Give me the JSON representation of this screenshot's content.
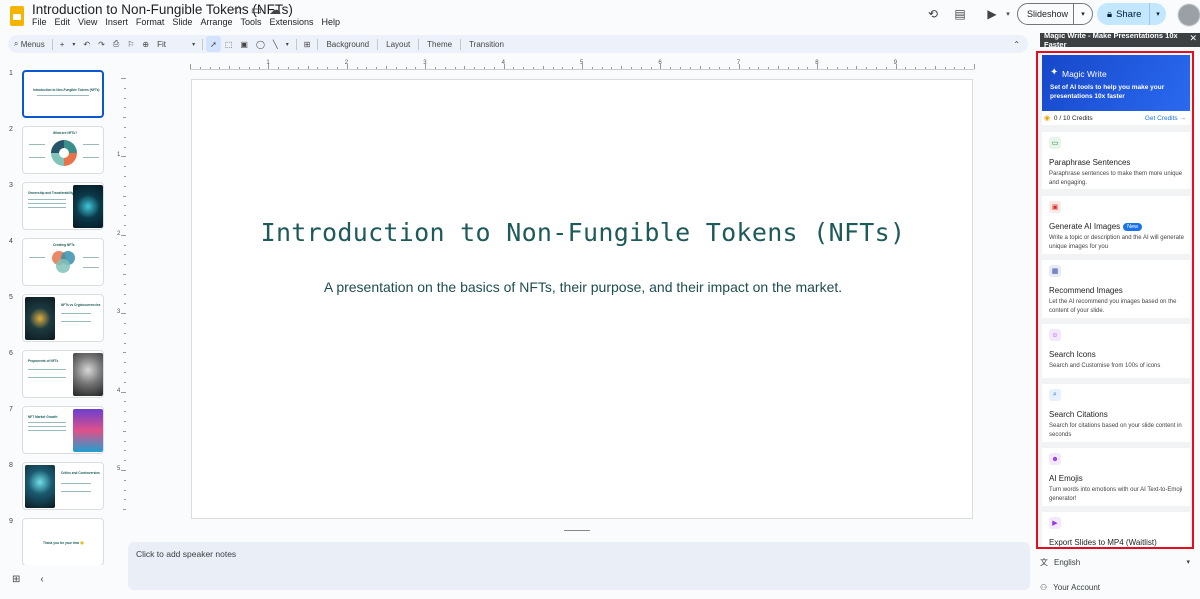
{
  "app": {
    "doc_title": "Introduction to Non-Fungible Tokens (NFTs)",
    "menu": [
      "File",
      "Edit",
      "View",
      "Insert",
      "Format",
      "Slide",
      "Arrange",
      "Tools",
      "Extensions",
      "Help"
    ],
    "slideshow_label": "Slideshow",
    "share_label": "Share"
  },
  "toolbar": {
    "menus_label": "Menus",
    "zoom_label": "Fit",
    "background_label": "Background",
    "layout_label": "Layout",
    "theme_label": "Theme",
    "transition_label": "Transition"
  },
  "ruler": {
    "top": [
      "1",
      "2",
      "3",
      "4",
      "5",
      "6",
      "7",
      "8",
      "9"
    ],
    "left": [
      "1",
      "2",
      "3",
      "4",
      "5"
    ]
  },
  "slides": [
    {
      "num": "1",
      "title": "Introduction to Non-Fungible Tokens (NFTs)"
    },
    {
      "num": "2",
      "title": "What are NFTs?"
    },
    {
      "num": "3",
      "title": "Ownership and Transferability"
    },
    {
      "num": "4",
      "title": "Creating NFTs"
    },
    {
      "num": "5",
      "title": "NFTs vs Cryptocurrencies"
    },
    {
      "num": "6",
      "title": "Proponents of NFTs"
    },
    {
      "num": "7",
      "title": "NFT Market Growth"
    },
    {
      "num": "8",
      "title": "Critics and Controversies"
    },
    {
      "num": "9",
      "title": "Thank you for your time 😊"
    }
  ],
  "current_slide": {
    "title": "Introduction to Non-Fungible Tokens (NFTs)",
    "subtitle": "A presentation on the basics of NFTs, their purpose, and their impact on the market."
  },
  "notes": {
    "placeholder": "Click to add speaker notes"
  },
  "magic_write": {
    "header": "Magic Write - Make Presentations 10x Faster",
    "hero_title": "Magic Write",
    "hero_subtitle": "Set of AI tools to help you make your presentations 10x faster",
    "credits": "0 / 10 Credits",
    "get_credits": "Get Credits",
    "tools": [
      {
        "title": "Paraphrase Sentences",
        "desc": "Paraphrase sentences to make them more unique and engaging.",
        "badge": ""
      },
      {
        "title": "Generate AI Images",
        "desc": "Write a topic or description and the AI will generate unique images for you",
        "badge": "New"
      },
      {
        "title": "Recommend Images",
        "desc": "Let the AI recommend you images based on the content of your slide.",
        "badge": ""
      },
      {
        "title": "Search Icons",
        "desc": "Search and Customise from 100s of icons",
        "badge": ""
      },
      {
        "title": "Search Citations",
        "desc": "Search for citations based on your slide content in seconds",
        "badge": ""
      },
      {
        "title": "AI Emojis",
        "desc": "Turn words into emotions with our AI Text-to-Emoji generator!",
        "badge": ""
      },
      {
        "title": "Export Slides to MP4 (Waitlist)",
        "desc": "",
        "badge": ""
      }
    ],
    "language": "English",
    "account": "Your Account"
  },
  "colors": {
    "accent_blue": "#0b57d0",
    "panel_border": "#e10f1f",
    "slide_title": "#1e5a5a",
    "hero_blue": "#1e5ce4"
  }
}
